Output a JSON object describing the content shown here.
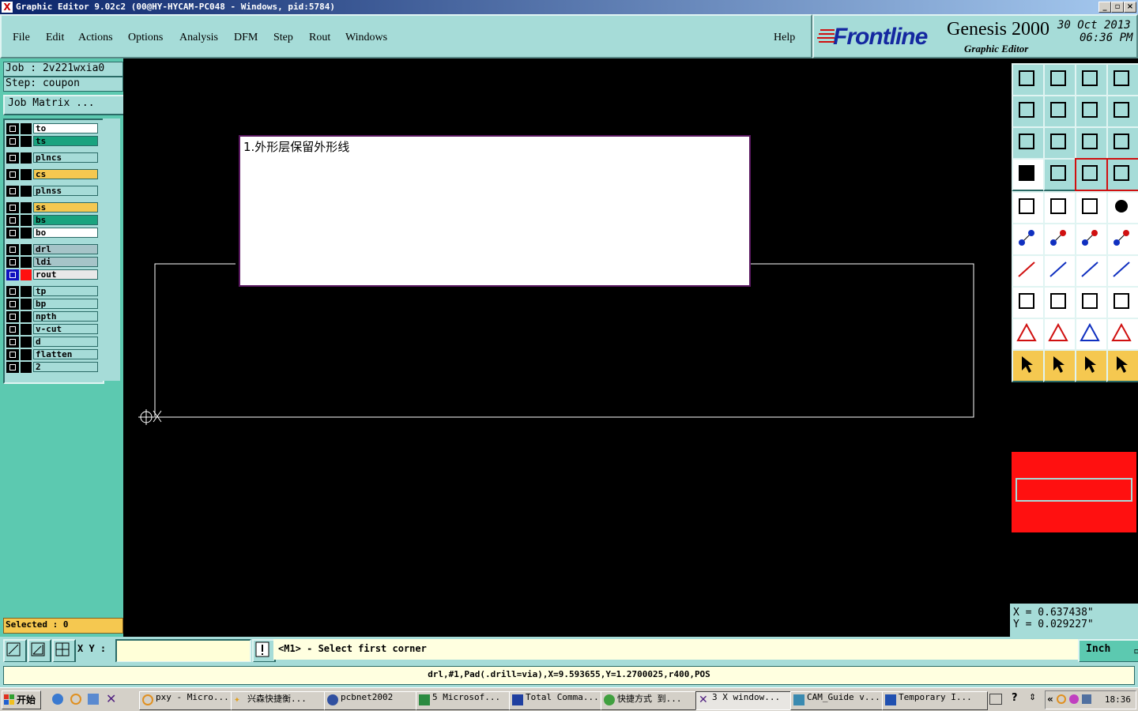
{
  "window": {
    "title": "Graphic Editor 9.02c2 (00@HY-HYCAM-PC048 - Windows, pid:5784)",
    "controls": [
      "_",
      "▫",
      "×"
    ]
  },
  "menubar": {
    "items": [
      "File",
      "Edit",
      "Actions",
      "Options",
      "Analysis",
      "DFM",
      "Step",
      "Rout",
      "Windows"
    ],
    "help": "Help"
  },
  "brand": {
    "logo": "Frontline",
    "product": "Genesis 2000",
    "subtitle": "Graphic Editor",
    "date": "30 Oct 2013",
    "time": "06:36 PM"
  },
  "job": {
    "job_label": "Job : 2v221wxia0",
    "step_label": "Step: coupon",
    "matrix_button": "Job Matrix ...",
    "selected": "Selected : 0"
  },
  "layers": [
    {
      "name": "to",
      "color": "#ffffff"
    },
    {
      "name": "ts",
      "color": "#1aa37f"
    },
    {
      "name": "plncs",
      "color": "#a6dcd8"
    },
    {
      "name": "cs",
      "color": "#f5c850"
    },
    {
      "name": "plnss",
      "color": "#a6dcd8"
    },
    {
      "name": "ss",
      "color": "#f5c850"
    },
    {
      "name": "bs",
      "color": "#1aa37f"
    },
    {
      "name": "bo",
      "color": "#ffffff"
    },
    {
      "name": "drl",
      "color": "#a6c4c8"
    },
    {
      "name": "ldi",
      "color": "#a6c4c8"
    },
    {
      "name": "rout",
      "color": "#e8e8e8",
      "active": true
    },
    {
      "name": "tp",
      "color": "#a6dcd8"
    },
    {
      "name": "bp",
      "color": "#a6dcd8"
    },
    {
      "name": "npth",
      "color": "#a6dcd8"
    },
    {
      "name": "v-cut",
      "color": "#a6dcd8"
    },
    {
      "name": "d",
      "color": "#a6dcd8"
    },
    {
      "name": "flatten",
      "color": "#a6dcd8"
    },
    {
      "name": "2",
      "color": "#a6dcd8"
    }
  ],
  "note": {
    "text": "1.外形层保留外形线"
  },
  "coords": {
    "x": "X = 0.637438\"",
    "y": "Y = 0.029227\""
  },
  "command": {
    "xy_label": "X Y :",
    "xy_value": "",
    "prompt": "<M1> - Select first corner",
    "units": "Inch"
  },
  "status": {
    "text": "drl,#1,Pad(.drill=via),X=9.593655,Y=1.2700025,r400,POS"
  },
  "taskbar": {
    "start": "开始",
    "tasks": [
      "pxy - Micro...",
      "兴森快捷衡...",
      "pcbnet2002",
      "5 Microsof...",
      "Total Comma...",
      "快捷方式 到...",
      "3 X window...",
      "CAM_Guide v...",
      "Temporary I..."
    ],
    "clock": "18:36"
  }
}
